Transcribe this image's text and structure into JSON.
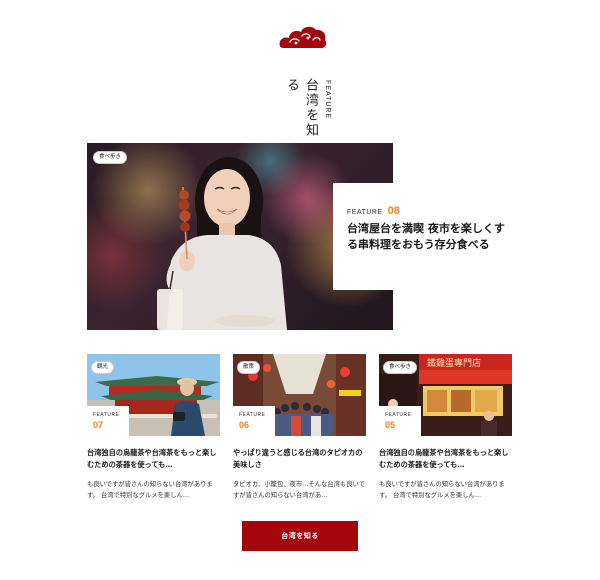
{
  "header": {
    "title_jp": "台湾を知る",
    "title_en": "FEATURE",
    "accent_color": "#a3070d",
    "icon": "auspicious-cloud-icon"
  },
  "hero": {
    "tag": "食べ歩き",
    "feature_label": "FEATURE",
    "feature_num": "08",
    "title": "台湾屋台を満喫 夜市を楽しくする串料理をおもう存分食べる"
  },
  "cards": [
    {
      "tag": "観光",
      "feature_label": "FEATURE",
      "feature_num": "07",
      "title": "台湾独自の烏龍茶や台湾茶をもっと楽しむための茶器を使っても…",
      "desc": "も良いですが皆さんの知らない台湾があります。 台湾で特別なグルメを楽しん…"
    },
    {
      "tag": "散策",
      "feature_label": "FEATURE",
      "feature_num": "06",
      "title": "やっぱり違うと感じる台湾のタピオカの美味しさ",
      "desc": "タピオカ、小籠包、夜市…そんな台湾も良いですが皆さんの知らない台湾があ…"
    },
    {
      "tag": "食べ歩き",
      "feature_label": "FEATURE",
      "feature_num": "05",
      "title": "台湾独自の烏龍茶や台湾茶をもっと楽しむための茶器を使っても…",
      "desc": "も良いですが皆さんの知らない台湾があります。 台湾で特別なグルメを楽しん…",
      "sign_text": "鐵雞蛋專門店"
    }
  ],
  "cta": {
    "label": "台湾を知る"
  },
  "colors": {
    "feature_num": "#e8871e",
    "cta_bg": "#a3070d"
  }
}
